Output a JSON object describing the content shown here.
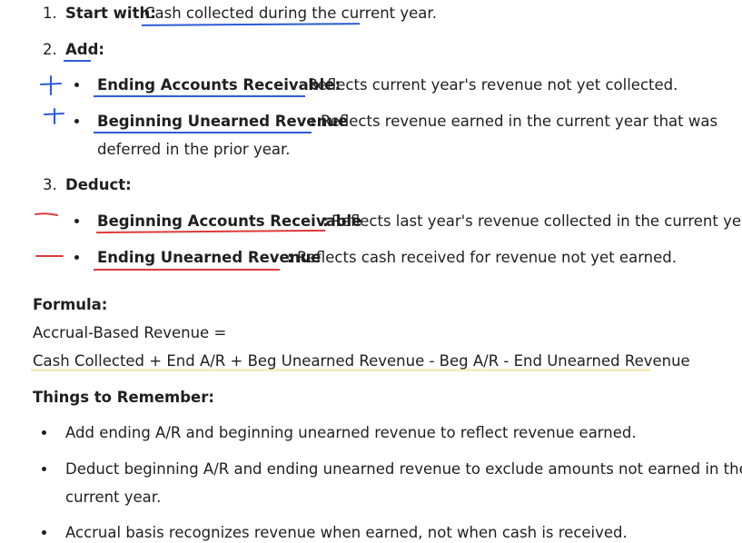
{
  "steps": [
    {
      "num": "1.",
      "label": "Start with:",
      "text": "Cash collected during the current year."
    },
    {
      "num": "2.",
      "label": "Add:"
    },
    {
      "num": "3.",
      "label": "Deduct:"
    }
  ],
  "add_items": [
    {
      "label": "Ending Accounts Receivable:",
      "text": "Reflects current year's revenue not yet collected."
    },
    {
      "label": "Beginning Unearned Revenue",
      "colon": ":",
      "text": "Reflects revenue earned in the current year that was",
      "text2": "deferred in the prior year."
    }
  ],
  "deduct_items": [
    {
      "label": "Beginning Accounts Receivable",
      "colon": ":",
      "text": "Reflects last year's revenue collected in the current year."
    },
    {
      "label": "Ending Unearned Revenue",
      "colon": ":",
      "text": "Reflects cash received for revenue not yet earned."
    }
  ],
  "formula": {
    "heading": "Formula:",
    "line1": "Accrual-Based Revenue =",
    "line2": "Cash Collected + End A/R + Beg Unearned Revenue - Beg A/R - End Unearned Revenue"
  },
  "remember": {
    "heading": "Things to Remember:",
    "items": [
      {
        "text": "Add ending A/R and beginning unearned revenue to reflect revenue earned."
      },
      {
        "text": "Deduct beginning A/R and ending unearned revenue to exclude amounts not earned in the",
        "text2": "current year."
      },
      {
        "text": "Accrual basis recognizes revenue when earned, not when cash is received."
      }
    ]
  },
  "colors": {
    "blue_ink": "#2b5bd7",
    "red_ink": "#e03a3a",
    "highlight": "#f6ecc0"
  }
}
